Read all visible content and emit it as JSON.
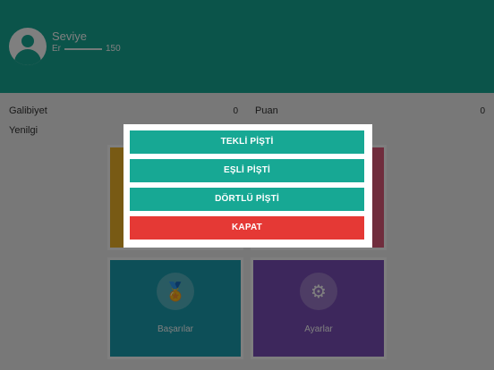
{
  "profile": {
    "level_title": "Seviye",
    "level_sub": "Er",
    "xp_value": "150"
  },
  "stats": {
    "wins_label": "Galibiyet",
    "wins_value": "0",
    "losses_label": "Yenilgi",
    "points_label": "Puan",
    "points_value": "0"
  },
  "tiles": [
    {
      "label": "",
      "color": "#f0b429",
      "icon": "cards-icon"
    },
    {
      "label": "",
      "color": "#e05a7a",
      "icon": "leaderboard-icon"
    },
    {
      "label": "Başarılar",
      "color": "#1b9fb0",
      "icon": "medal-icon"
    },
    {
      "label": "Ayarlar",
      "color": "#7b4fb8",
      "icon": "gear-icon"
    }
  ],
  "dialog": {
    "single_label": "TEKLİ PİŞTİ",
    "pair_label": "EŞLİ PİŞTİ",
    "four_label": "DÖRTLÜ PİŞTİ",
    "close_label": "KAPAT",
    "primary_color": "#17a894",
    "close_color": "#e53935"
  }
}
